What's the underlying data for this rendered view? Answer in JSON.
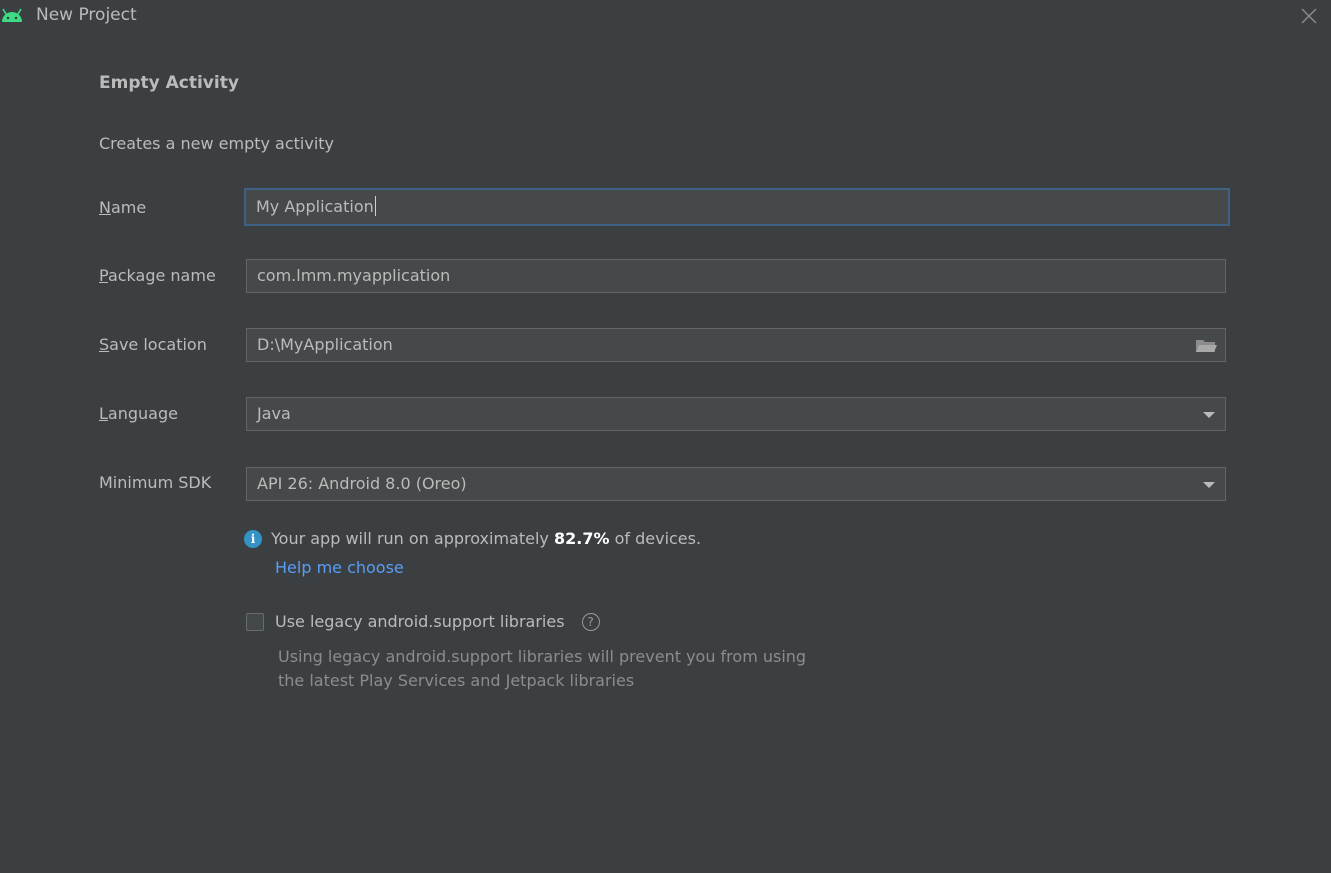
{
  "window": {
    "title": "New Project",
    "app_icon": "android-icon",
    "close_icon": "close-icon"
  },
  "activity": {
    "heading": "Empty Activity",
    "description": "Creates a new empty activity"
  },
  "form": {
    "name": {
      "label_mnemonic": "N",
      "label_rest": "ame",
      "value": "My Application"
    },
    "package_name": {
      "label_mnemonic": "P",
      "label_rest": "ackage name",
      "value": "com.lmm.myapplication"
    },
    "save_location": {
      "label_mnemonic": "S",
      "label_rest": "ave location",
      "value": "D:\\MyApplication",
      "browse_icon": "folder-icon"
    },
    "language": {
      "label_mnemonic": "L",
      "label_rest": "anguage",
      "value": "Java"
    },
    "minimum_sdk": {
      "label": "Minimum SDK",
      "value": "API 26: Android 8.0 (Oreo)"
    }
  },
  "info": {
    "prefix": "Your app will run on approximately ",
    "percent": "82.7%",
    "suffix": " of devices.",
    "help_link": "Help me choose"
  },
  "legacy": {
    "checked": false,
    "label": "Use legacy android.support libraries",
    "note_line1": "Using legacy android.support libraries will prevent you from using",
    "note_line2": "the latest Play Services and Jetpack libraries"
  },
  "colors": {
    "background": "#3c3f41",
    "field_bg": "#45494a",
    "focus_border": "#3d6185",
    "link": "#589df6",
    "info_icon": "#3592c4",
    "android_green": "#3ddc84"
  }
}
